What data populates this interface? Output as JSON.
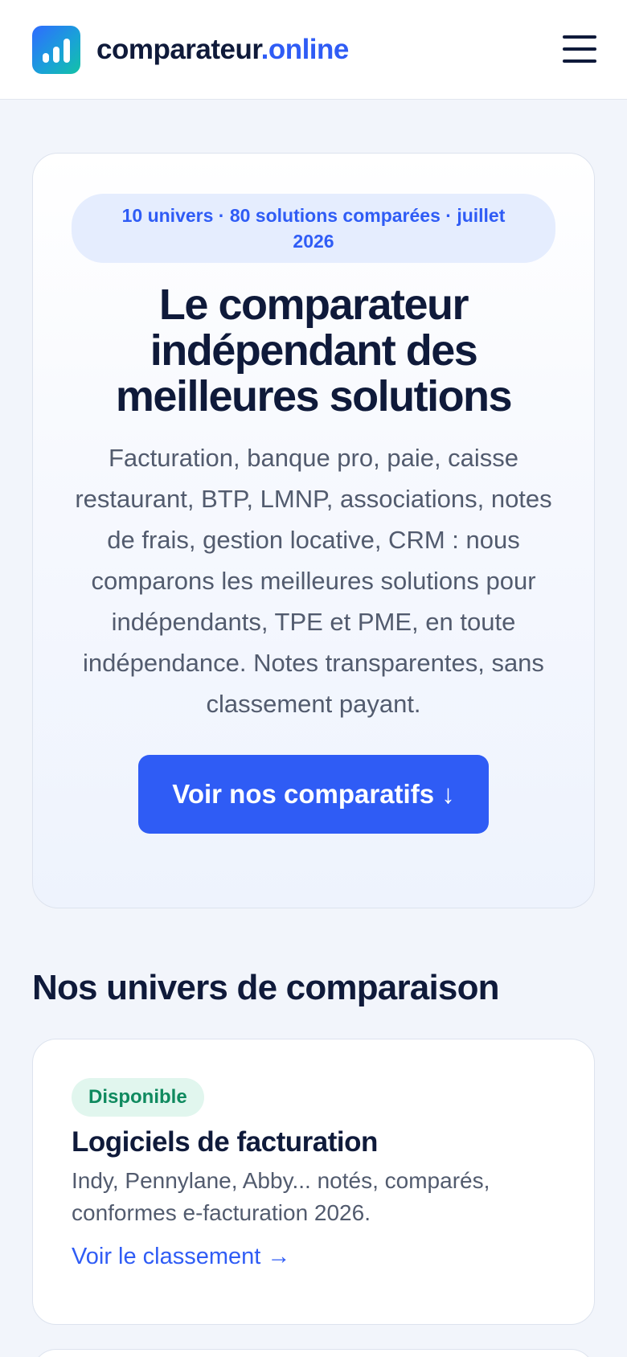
{
  "header": {
    "brand_name": "comparateur",
    "brand_tld": ".online",
    "menu_icon": "hamburger-menu-icon",
    "logo_icon": "bar-chart-icon"
  },
  "hero": {
    "pill": "10 univers · 80 solutions comparées · juillet 2026",
    "title": "Le comparateur indépendant des meilleures solutions",
    "description": "Facturation, banque pro, paie, caisse restaurant, BTP, LMNP, associations, notes de frais, gestion locative, CRM : nous comparons les meilleures solutions pour indépendants, TPE et PME, en toute indépendance. Notes transparentes, sans classement payant.",
    "cta_label": "Voir nos comparatifs ↓"
  },
  "section": {
    "title": "Nos univers de comparaison",
    "cards": [
      {
        "badge": "Disponible",
        "title": "Logiciels de facturation",
        "description": "Indy, Pennylane, Abby... notés, comparés, conformes e-facturation 2026.",
        "link": "Voir le classement →"
      }
    ]
  },
  "colors": {
    "accent": "#2f5cf5",
    "heading": "#0f1a3a",
    "body_text": "#525b6e",
    "badge_bg": "#e1f6ee",
    "badge_text": "#0f8a5f",
    "pill_bg": "#e5edfe"
  }
}
